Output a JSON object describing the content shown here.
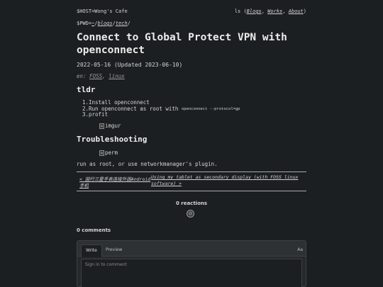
{
  "header": {
    "host_prefix": "$HOST=",
    "host": "Wong's Cafe",
    "ls": "ls (",
    "nav": [
      "Blogs",
      "Works",
      "About"
    ],
    "sep": ", ",
    "close": ")"
  },
  "pwd": {
    "prefix": "$PWD=",
    "path": [
      "~",
      "/",
      "blogs",
      "/",
      "tech",
      "/"
    ]
  },
  "post": {
    "title": "Connect to Global Protect VPN with openconnect",
    "date": "2022-05-16 (Updated 2023-06-10)",
    "tags_prefix": "en: ",
    "tags": [
      "FOSS",
      "linux"
    ],
    "tags_sep": ", ",
    "section_tldr": "tldr",
    "steps": [
      {
        "num": "1.",
        "text": "Install openconnect",
        "code": ""
      },
      {
        "num": "2.",
        "text": "Run openconnect as root with ",
        "code": "openconnect --protocol=gp"
      },
      {
        "num": "3.",
        "text": "profit",
        "code": ""
      }
    ],
    "image_imgur_alt": "imgur",
    "section_trouble": "Troubleshooting",
    "image_perm_alt": "perm",
    "run_text": "run as root, or use networkmanager's plugin."
  },
  "postnav": {
    "prev": "< 国行三星手表连接外国Android手机",
    "next": "Using my tablet as secondary display (with FOSS linux software) >"
  },
  "reactions": {
    "label": "0 reactions",
    "icon": "smiley-icon"
  },
  "comments": {
    "count_label": "0 comments",
    "tab_write": "Write",
    "tab_preview": "Preview",
    "format_label": "Aa",
    "placeholder": "Sign in to comment"
  }
}
